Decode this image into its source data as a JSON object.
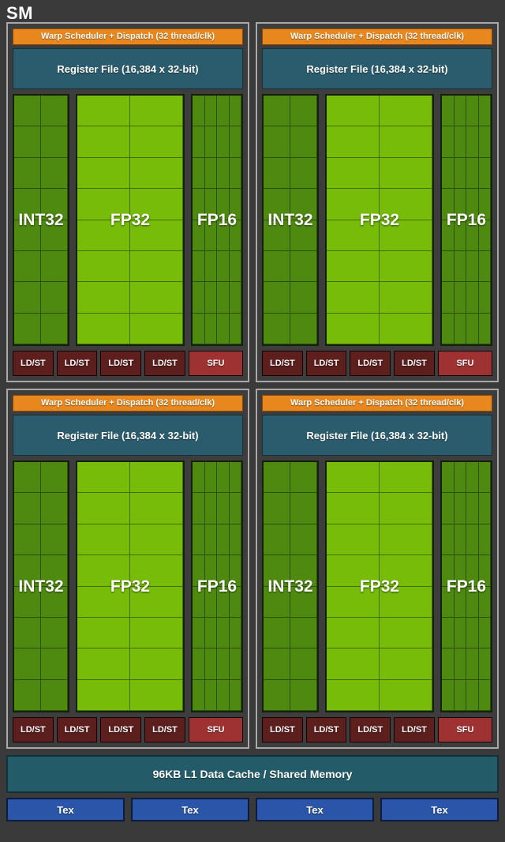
{
  "diagram": {
    "title": "SM",
    "background_color": "#3a3a3a"
  },
  "processing_block": {
    "warp_scheduler_label": "Warp Scheduler + Dispatch (32 thread/clk)",
    "register_file_label": "Register File (16,384 x 32-bit)",
    "cores": [
      {
        "label": "INT32",
        "columns": 2,
        "rows": 8,
        "color": "#4f8a10"
      },
      {
        "label": "FP32",
        "columns": 2,
        "rows": 8,
        "color": "#76bc08"
      },
      {
        "label": "FP16",
        "columns": 4,
        "rows": 8,
        "color": "#4f8a10"
      }
    ],
    "units": [
      {
        "label": "LD/ST",
        "type": "ldst",
        "color": "#5d1e1e"
      },
      {
        "label": "LD/ST",
        "type": "ldst",
        "color": "#5d1e1e"
      },
      {
        "label": "LD/ST",
        "type": "ldst",
        "color": "#5d1e1e"
      },
      {
        "label": "LD/ST",
        "type": "ldst",
        "color": "#5d1e1e"
      },
      {
        "label": "SFU",
        "type": "sfu",
        "color": "#9e3232"
      }
    ],
    "warp_scheduler_color": "#e8871e",
    "register_file_color": "#2b5c6e"
  },
  "processing_block_count": 4,
  "cache": {
    "label": "96KB L1 Data Cache / Shared Memory",
    "color": "#235c68"
  },
  "texture_units": {
    "color": "#2b55a8",
    "items": [
      {
        "label": "Tex"
      },
      {
        "label": "Tex"
      },
      {
        "label": "Tex"
      },
      {
        "label": "Tex"
      }
    ]
  }
}
